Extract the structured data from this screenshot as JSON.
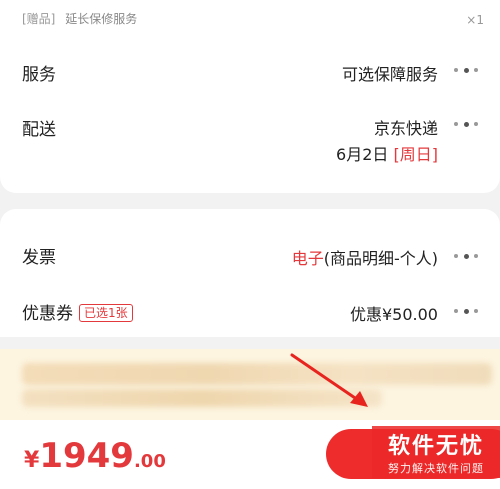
{
  "gift": {
    "tag": "[赠品]",
    "name": "延长保修服务",
    "qty": "×1"
  },
  "service": {
    "label": "服务",
    "value": "可选保障服务"
  },
  "delivery": {
    "label": "配送",
    "carrier": "京东快递",
    "date": "6月2日",
    "weekday": "[周日]"
  },
  "invoice": {
    "label": "发票",
    "type": "电子",
    "detail": "(商品明细-个人)"
  },
  "coupon": {
    "label": "优惠券",
    "badge": "已选1张",
    "value": "优惠¥50.00"
  },
  "footer": {
    "currency": "¥",
    "price_int": "1949",
    "price_dec": ".00"
  },
  "watermark": {
    "title": "软件无忧",
    "subtitle": "努力解决软件问题"
  },
  "colors": {
    "accent": "#e4393c",
    "button": "#ee2c2c",
    "notice_bg": "#fdf5e0",
    "page_bg": "#f2f2f2"
  }
}
